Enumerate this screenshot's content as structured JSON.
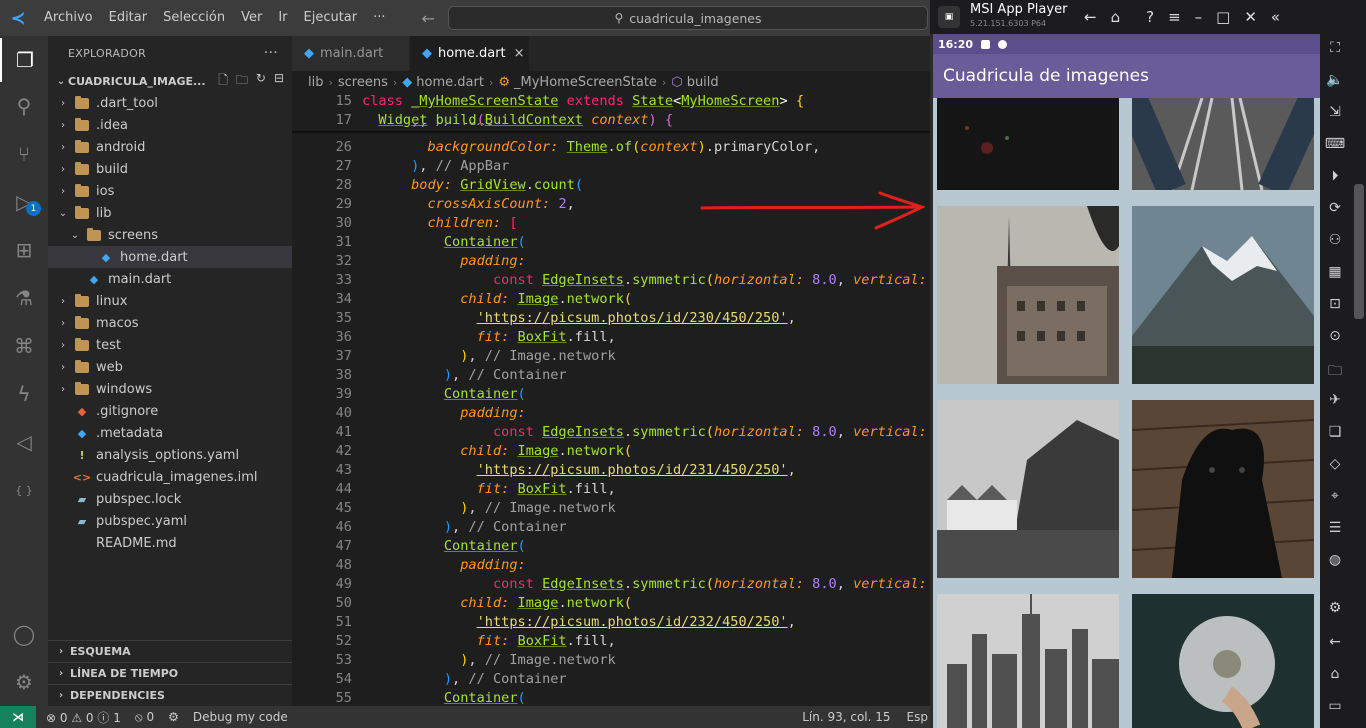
{
  "vscode": {
    "logo": "vscode-logo",
    "menu": [
      "Archivo",
      "Editar",
      "Selección",
      "Ver",
      "Ir",
      "Ejecutar",
      "···"
    ],
    "search_text": "cuadricula_imagenes",
    "explorer": {
      "title": "EXPLORADOR",
      "more": "···",
      "folder": "CUADRICULA_IMAGE...",
      "tree": [
        {
          "label": ".dart_tool",
          "type": "folder",
          "state": "collapsed"
        },
        {
          "label": ".idea",
          "type": "folder",
          "state": "collapsed"
        },
        {
          "label": "android",
          "type": "folder",
          "state": "collapsed"
        },
        {
          "label": "build",
          "type": "folder",
          "state": "collapsed"
        },
        {
          "label": "ios",
          "type": "folder",
          "state": "collapsed"
        },
        {
          "label": "lib",
          "type": "folder",
          "state": "expanded"
        },
        {
          "label": "screens",
          "type": "folder",
          "state": "expanded"
        },
        {
          "label": "home.dart",
          "type": "dart",
          "state": "selected"
        },
        {
          "label": "main.dart",
          "type": "dart",
          "state": ""
        },
        {
          "label": "linux",
          "type": "folder",
          "state": "collapsed"
        },
        {
          "label": "macos",
          "type": "folder",
          "state": "collapsed"
        },
        {
          "label": "test",
          "type": "folder",
          "state": "collapsed"
        },
        {
          "label": "web",
          "type": "folder",
          "state": "collapsed"
        },
        {
          "label": "windows",
          "type": "folder",
          "state": "collapsed"
        },
        {
          "label": ".gitignore",
          "type": "git",
          "state": ""
        },
        {
          "label": ".metadata",
          "type": "meta",
          "state": ""
        },
        {
          "label": "analysis_options.yaml",
          "type": "yaml",
          "state": ""
        },
        {
          "label": "cuadricula_imagenes.iml",
          "type": "iml",
          "state": ""
        },
        {
          "label": "pubspec.lock",
          "type": "lock",
          "state": ""
        },
        {
          "label": "pubspec.yaml",
          "type": "lock",
          "state": ""
        },
        {
          "label": "README.md",
          "type": "md",
          "state": ""
        }
      ],
      "sections": [
        "ESQUEMA",
        "LÍNEA DE TIEMPO",
        "DEPENDENCIES"
      ]
    },
    "activity_badge": "1",
    "tabs": [
      {
        "label": "main.dart",
        "active": false
      },
      {
        "label": "home.dart",
        "active": true,
        "close": "×"
      }
    ],
    "breadcrumbs": [
      "lib",
      "screens",
      "home.dart",
      "_MyHomeScreenState",
      "build"
    ],
    "code_lines": [
      {
        "n": "15",
        "html": "<span class='k'>class</span> <span class='t'>_MyHomeScreenState</span> <span class='k'>extends</span> <span class='t'>State</span><span class='w'>&lt;</span><span class='t'>MyHomeScreen</span><span class='w'>&gt;</span> <span class='b1'>{</span>"
      },
      {
        "n": "17",
        "html": "  <span class='t'>Widget</span> <span class='fn'>build</span><span class='b2'>(</span><span class='t'>BuildContext</span> <span class='p'>context</span><span class='b2'>)</span> <span class='b2'>{</span>"
      },
      {
        "n": "26",
        "html": "        <span class='p'>backgroundColor:</span> <span class='t'>Theme</span>.<span class='fn'>of</span><span class='b1'>(</span><span class='p'>context</span><span class='b1'>)</span>.primaryColor,"
      },
      {
        "n": "27",
        "html": "      <span class='b3'>)</span>, <span class='c'>// AppBar</span>"
      },
      {
        "n": "28",
        "html": "      <span class='p'>body:</span> <span class='t'>GridView</span>.<span class='fn'>count</span><span class='b3'>(</span>"
      },
      {
        "n": "29",
        "html": "        <span class='p'>crossAxisCount:</span> <span class='n'>2</span>,"
      },
      {
        "n": "30",
        "html": "        <span class='p'>children:</span> <span class='k'>[</span>"
      },
      {
        "n": "31",
        "html": "          <span class='t'>Container</span><span class='b3'>(</span>"
      },
      {
        "n": "32",
        "html": "            <span class='p'>padding:</span>"
      },
      {
        "n": "33",
        "html": "                <span class='k'>const</span> <span class='t'>EdgeInsets</span>.<span class='fn'>symmetric</span><span class='b1'>(</span><span class='p'>horizontal:</span> <span class='n'>8.0</span>, <span class='p'>vertical:</span> <span class='n'>8.0</span><span class='b1'>)</span>,"
      },
      {
        "n": "34",
        "html": "            <span class='p'>child:</span> <span class='t'>Image</span>.<span class='fn'>network</span><span class='b1'>(</span>"
      },
      {
        "n": "35",
        "html": "              <span class='s'>'https://picsum.photos/id/230/450/250'</span>,"
      },
      {
        "n": "36",
        "html": "              <span class='p'>fit:</span> <span class='t'>BoxFit</span>.fill,"
      },
      {
        "n": "37",
        "html": "            <span class='b1'>)</span>, <span class='c'>// Image.network</span>"
      },
      {
        "n": "38",
        "html": "          <span class='b3'>)</span>, <span class='c'>// Container</span>"
      },
      {
        "n": "39",
        "html": "          <span class='t'>Container</span><span class='b3'>(</span>"
      },
      {
        "n": "40",
        "html": "            <span class='p'>padding:</span>"
      },
      {
        "n": "41",
        "html": "                <span class='k'>const</span> <span class='t'>EdgeInsets</span>.<span class='fn'>symmetric</span><span class='b1'>(</span><span class='p'>horizontal:</span> <span class='n'>8.0</span>, <span class='p'>vertical:</span> <span class='n'>8.0</span><span class='b1'>)</span>,"
      },
      {
        "n": "42",
        "html": "            <span class='p'>child:</span> <span class='t'>Image</span>.<span class='fn'>network</span><span class='b1'>(</span>"
      },
      {
        "n": "43",
        "html": "              <span class='s'>'https://picsum.photos/id/231/450/250'</span>,"
      },
      {
        "n": "44",
        "html": "              <span class='p'>fit:</span> <span class='t'>BoxFit</span>.fill,"
      },
      {
        "n": "45",
        "html": "            <span class='b1'>)</span>, <span class='c'>// Image.network</span>"
      },
      {
        "n": "46",
        "html": "          <span class='b3'>)</span>, <span class='c'>// Container</span>"
      },
      {
        "n": "47",
        "html": "          <span class='t'>Container</span><span class='b3'>(</span>"
      },
      {
        "n": "48",
        "html": "            <span class='p'>padding:</span>"
      },
      {
        "n": "49",
        "html": "                <span class='k'>const</span> <span class='t'>EdgeInsets</span>.<span class='fn'>symmetric</span><span class='b1'>(</span><span class='p'>horizontal:</span> <span class='n'>8.0</span>, <span class='p'>vertical:</span> <span class='n'>8.0</span><span class='b1'>)</span>,"
      },
      {
        "n": "50",
        "html": "            <span class='p'>child:</span> <span class='t'>Image</span>.<span class='fn'>network</span><span class='b1'>(</span>"
      },
      {
        "n": "51",
        "html": "              <span class='s'>'https://picsum.photos/id/232/450/250'</span>,"
      },
      {
        "n": "52",
        "html": "              <span class='p'>fit:</span> <span class='t'>BoxFit</span>.fill,"
      },
      {
        "n": "53",
        "html": "            <span class='b1'>)</span>, <span class='c'>// Image.network</span>"
      },
      {
        "n": "54",
        "html": "          <span class='b3'>)</span>, <span class='c'>// Container</span>"
      },
      {
        "n": "55",
        "html": "          <span class='t'>Container</span><span class='b3'>(</span>"
      }
    ],
    "status": {
      "errors": "0",
      "warnings": "0",
      "info": "1",
      "ports": "0",
      "debug": "Debug my code",
      "position": "Lín. 93, col. 15",
      "spaces": "Esp"
    }
  },
  "emulator": {
    "title": "MSI App Player",
    "version": "5.21.151.6303  P64",
    "phone": {
      "time": "16:20",
      "app_title": "Cuadricula de imagenes"
    }
  },
  "colors": {
    "appbar": "#6a5b99",
    "status_bar": "#5b4e8c",
    "annotation_arrow": "#e0201c"
  }
}
